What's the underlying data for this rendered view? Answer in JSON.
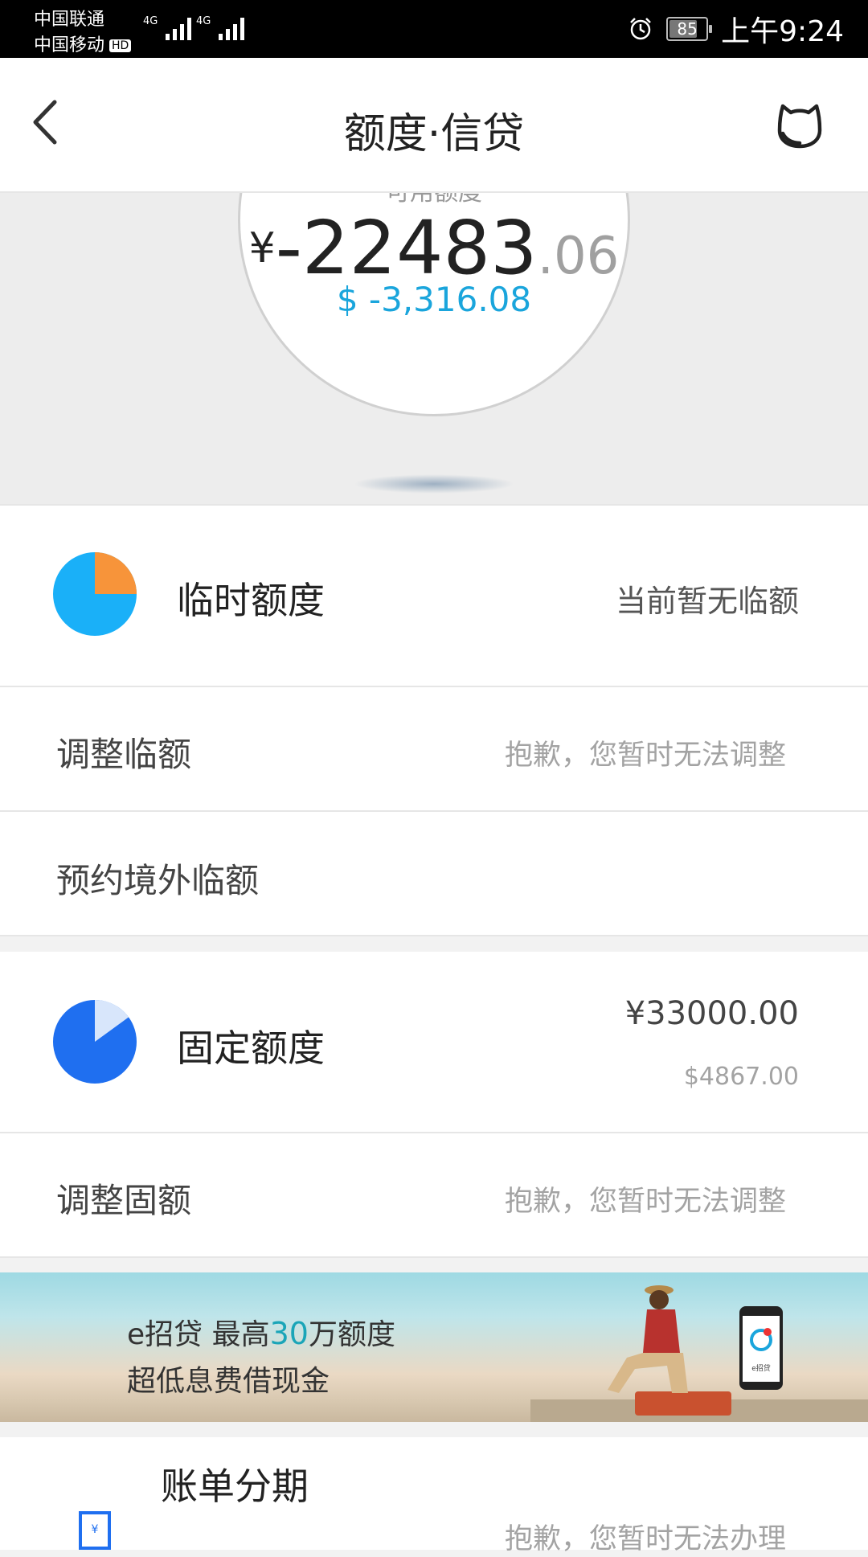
{
  "status_bar": {
    "carrier_1": "中国联通",
    "carrier_2": "中国移动",
    "hd_badge": "HD",
    "network_1": "4G",
    "network_2": "4G",
    "battery": "85",
    "time": "上午9:24"
  },
  "nav": {
    "title": "额度·信贷"
  },
  "hero": {
    "label": "可用额度",
    "currency_symbol": "¥",
    "amount_integer": "-22483",
    "amount_decimal": ".06",
    "usd_amount": "$ -3,316.08"
  },
  "temporary_limit": {
    "title": "临时额度",
    "status": "当前暂无临额",
    "pie_fraction": 0.25,
    "pie_colors": {
      "base": "#1ab0f8",
      "slice": "#f7943a"
    }
  },
  "adjust_temp": {
    "title": "调整临额",
    "status": "抱歉，您暂时无法调整"
  },
  "book_overseas": {
    "title": "预约境外临额"
  },
  "fixed_limit": {
    "title": "固定额度",
    "cny_amount": "¥33000.00",
    "usd_amount": "$4867.00",
    "pie_fraction": 0.15,
    "pie_colors": {
      "base": "#1f6ff0",
      "slice": "#d8e6fb"
    }
  },
  "adjust_fixed": {
    "title": "调整固额",
    "status": "抱歉，您暂时无法调整"
  },
  "banner": {
    "line1_prefix": "e招贷  最高",
    "line1_highlight": "30",
    "line1_suffix": "万额度",
    "line2": "超低息费借现金",
    "phone_label": "e招贷"
  },
  "installment": {
    "title": "账单分期",
    "status": "抱歉，您暂时无法办理",
    "icon_glyph": "¥"
  }
}
